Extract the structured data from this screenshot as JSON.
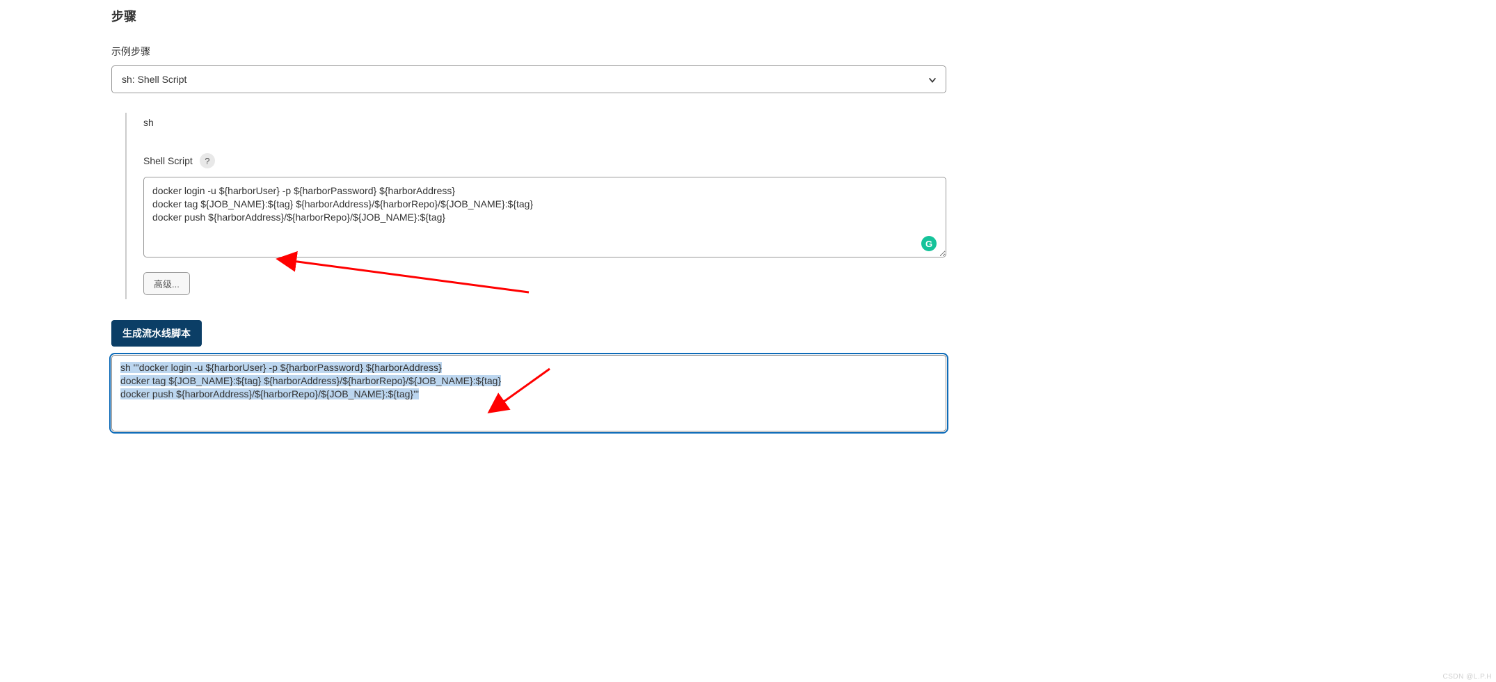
{
  "section": {
    "title": "步骤"
  },
  "example": {
    "label": "示例步骤",
    "select_value": "sh: Shell Script"
  },
  "step": {
    "command_name": "sh",
    "script_label": "Shell Script",
    "help_symbol": "?",
    "script_value": "docker login -u ${harborUser} -p ${harborPassword} ${harborAddress}\ndocker tag ${JOB_NAME}:${tag} ${harborAddress}/${harborRepo}/${JOB_NAME}:${tag}\ndocker push ${harborAddress}/${harborRepo}/${JOB_NAME}:${tag}",
    "advanced_button": "高级...",
    "grammarly_glyph": "G"
  },
  "generate": {
    "button_label": "生成流水线脚本",
    "output_value": "sh '''docker login -u ${harborUser} -p ${harborPassword} ${harborAddress}\ndocker tag ${JOB_NAME}:${tag} ${harborAddress}/${harborRepo}/${JOB_NAME}:${tag}\ndocker push ${harborAddress}/${harborRepo}/${JOB_NAME}:${tag}'''"
  },
  "watermark": "CSDN @L.P.H"
}
